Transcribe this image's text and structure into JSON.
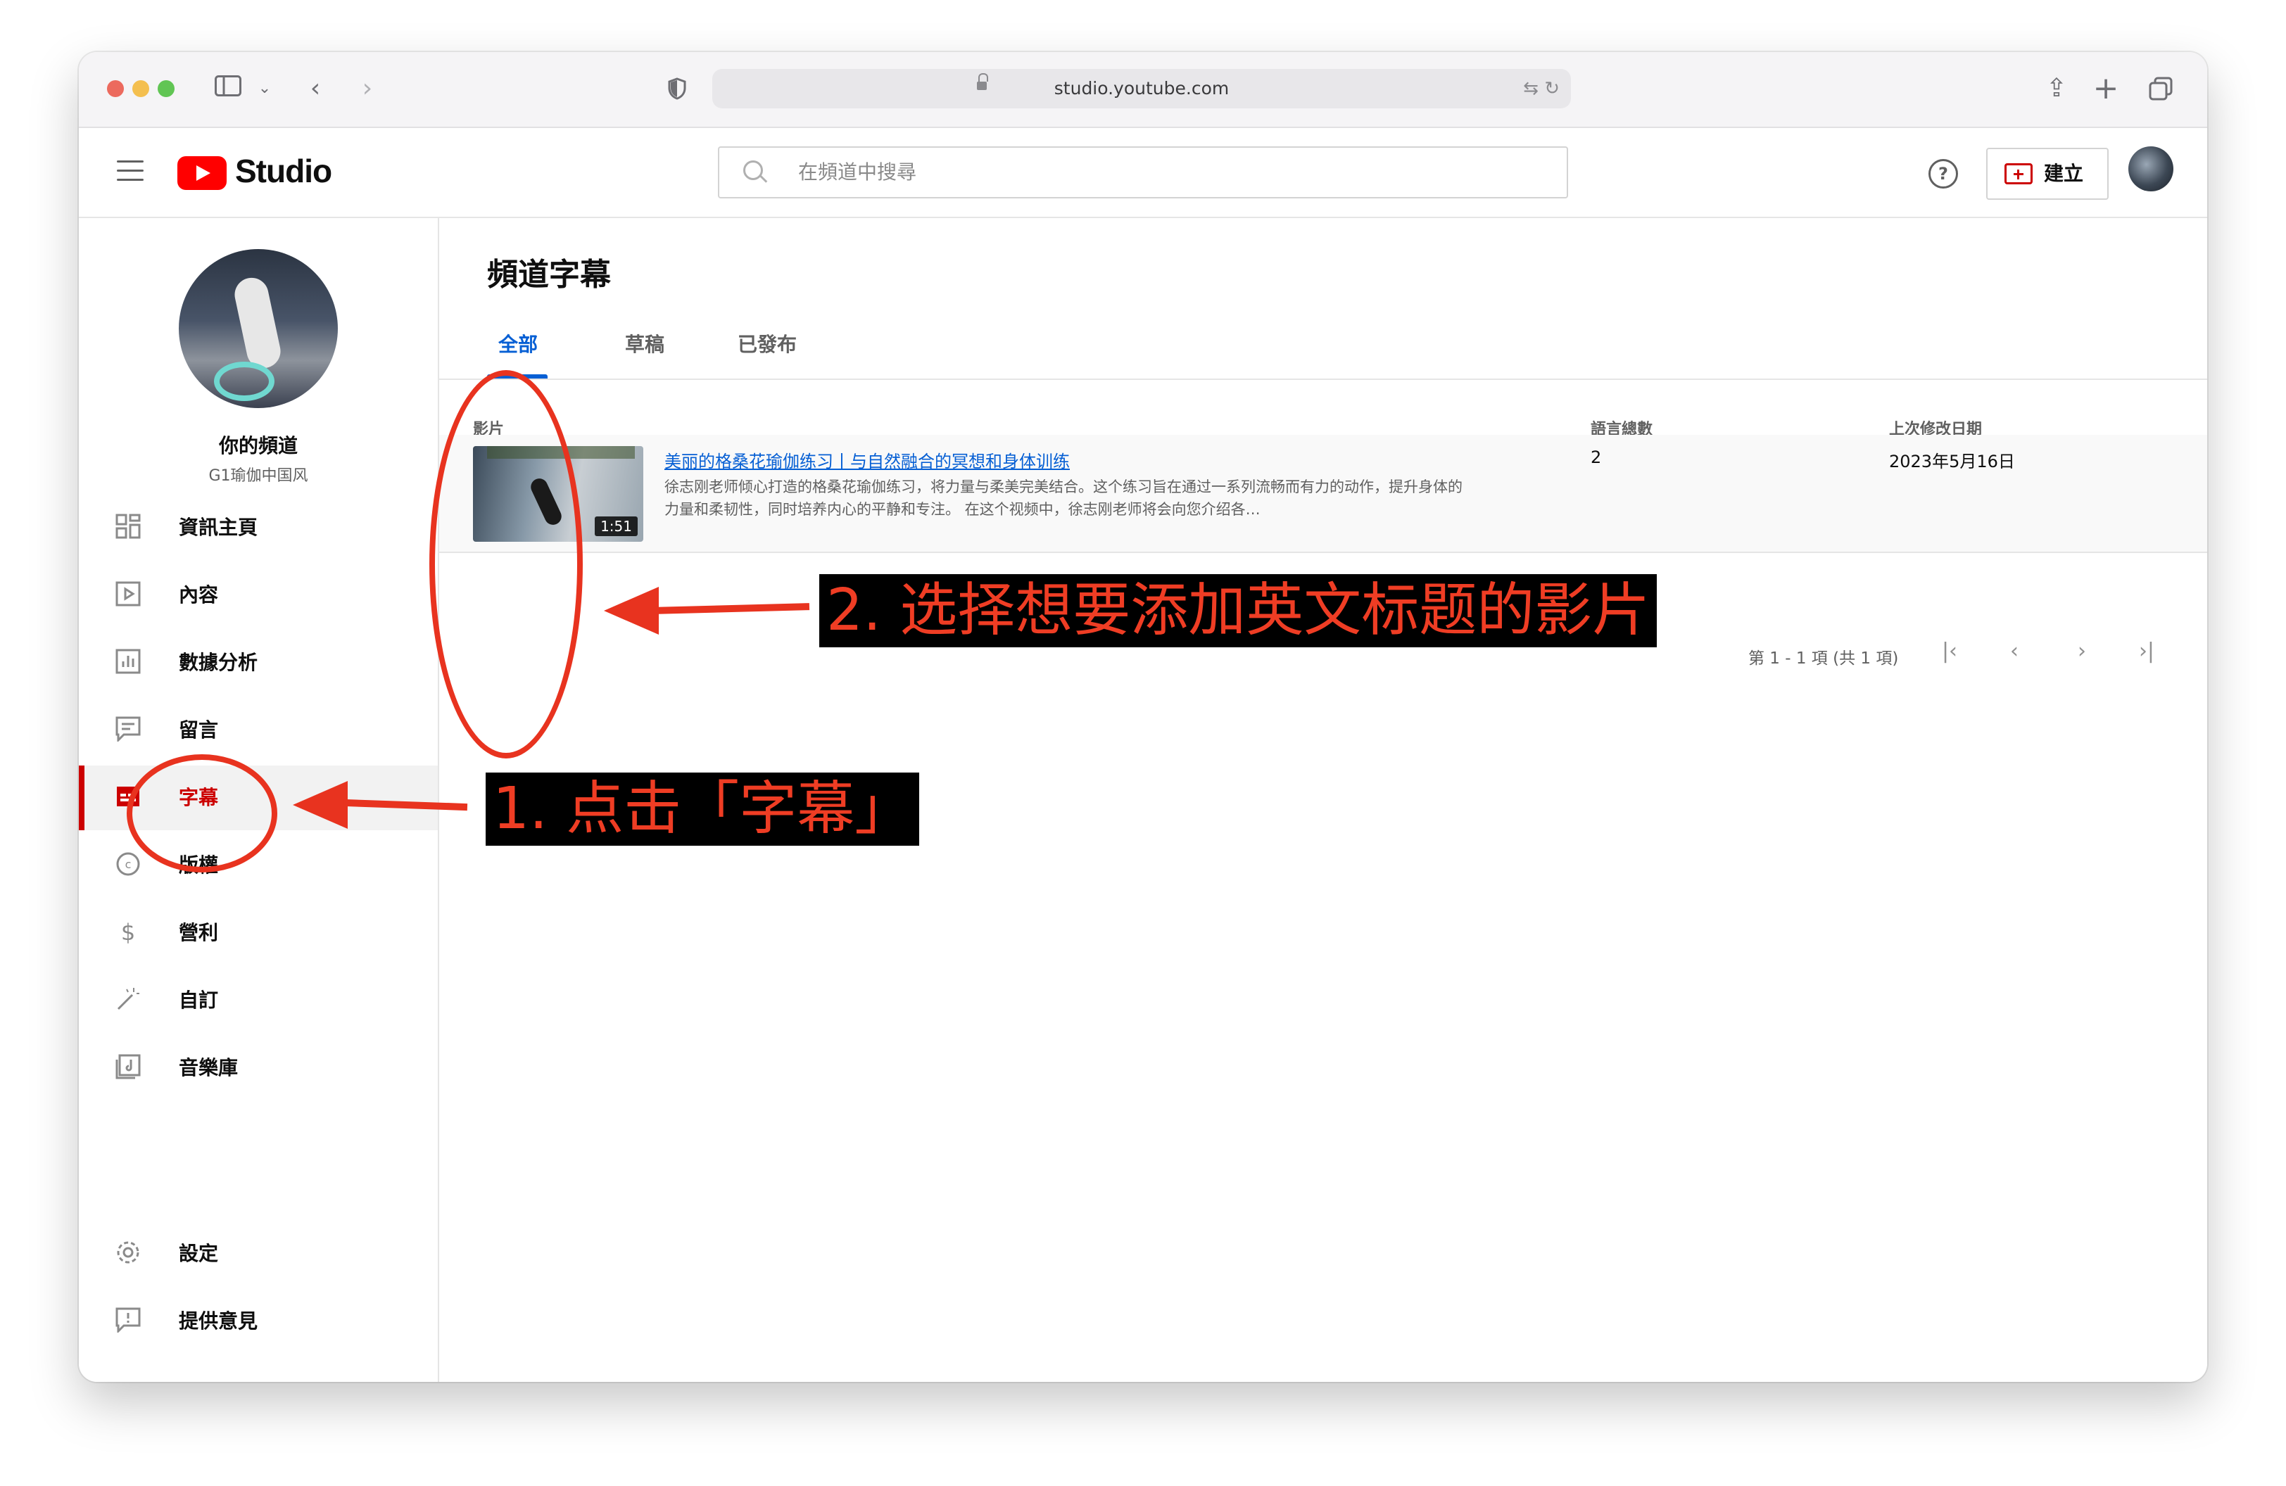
{
  "browser": {
    "url": "studio.youtube.com"
  },
  "header": {
    "app_name": "Studio",
    "search_placeholder": "在頻道中搜尋",
    "create_label": "建立"
  },
  "sidebar": {
    "channel_title": "你的頻道",
    "channel_handle": "G1瑜伽中国风",
    "items": [
      {
        "label": "資訊主頁",
        "icon": "dashboard-icon"
      },
      {
        "label": "內容",
        "icon": "content-icon"
      },
      {
        "label": "數據分析",
        "icon": "analytics-icon"
      },
      {
        "label": "留言",
        "icon": "comments-icon"
      },
      {
        "label": "字幕",
        "icon": "subtitles-icon",
        "active": true
      },
      {
        "label": "版權",
        "icon": "copyright-icon"
      },
      {
        "label": "營利",
        "icon": "monetization-icon"
      },
      {
        "label": "自訂",
        "icon": "customization-icon"
      },
      {
        "label": "音樂庫",
        "icon": "audio-library-icon"
      }
    ],
    "bottom_items": [
      {
        "label": "設定",
        "icon": "settings-icon"
      },
      {
        "label": "提供意見",
        "icon": "feedback-icon"
      }
    ]
  },
  "main": {
    "title": "頻道字幕",
    "tabs": [
      {
        "label": "全部",
        "active": true
      },
      {
        "label": "草稿"
      },
      {
        "label": "已發布"
      }
    ],
    "columns": [
      "影片",
      "語言總數",
      "上次修改日期"
    ],
    "rows": [
      {
        "title": "美丽的格桑花瑜伽练习丨与自然融合的冥想和身体训练",
        "description": "徐志刚老师倾心打造的格桑花瑜伽练习，将力量与柔美完美结合。这个练习旨在通过一系列流畅而有力的动作，提升身体的力量和柔韧性，同时培养内心的平静和专注。 在这个视频中，徐志刚老师将会向您介绍各…",
        "duration": "1:51",
        "language_count": "2",
        "last_modified": "2023年5月16日"
      }
    ],
    "pagination": "第 1 - 1 項 (共 1 項)"
  },
  "annotations": {
    "step1": "1. 点击「字幕」",
    "step2": "2. 选择想要添加英文标题的影片",
    "accent_color": "#e8331f"
  }
}
